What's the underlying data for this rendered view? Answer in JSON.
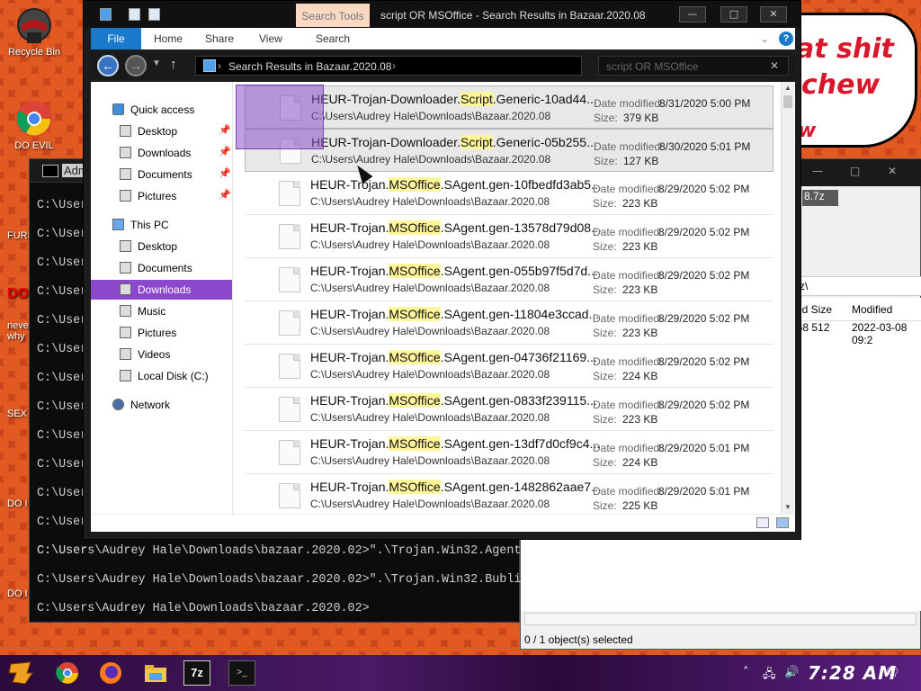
{
  "desktop": {
    "icons": [
      {
        "label": "Recycle Bin"
      },
      {
        "label": "DO EVIL"
      }
    ],
    "side_labels": [
      "FURF",
      "DO",
      "neve why",
      "SEX",
      "DO I",
      "DO I"
    ],
    "comic_lines": [
      "at shit",
      "chew",
      "w"
    ]
  },
  "cmd": {
    "title": "Adm",
    "prompts": [
      "C:\\User",
      "C:\\User",
      "C:\\User",
      "C:\\User",
      "C:\\User",
      "C:\\User",
      "C:\\User",
      "C:\\User",
      "C:\\User",
      "C:\\User",
      "C:\\User",
      "C:\\User",
      "C:\\User"
    ],
    "lines": [
      "C:\\Users\\Audrey Hale\\Downloads\\bazaar.2020.02>\".\\Trojan.Win32.Agent",
      "C:\\Users\\Audrey Hale\\Downloads\\bazaar.2020.02>\".\\Trojan.Win32.Bubli",
      "C:\\Users\\Audrey Hale\\Downloads\\bazaar.2020.02>"
    ]
  },
  "zip": {
    "archive_suffix": "8.7z",
    "path_suffix": "z\\",
    "columns": [
      "ked Size",
      "Modified"
    ],
    "row": {
      "size": "568 512",
      "modified": "2022-03-08 09:2"
    },
    "status": "0 / 1 object(s) selected"
  },
  "explorer": {
    "context_tab": "Search Tools",
    "window_title": "script OR MSOffice - Search Results in Bazaar.2020.08",
    "window_buttons": [
      "—",
      "□",
      "✕"
    ],
    "ribbon_tabs": [
      "File",
      "Home",
      "Share",
      "View",
      "Search"
    ],
    "address": "Search Results in Bazaar.2020.08",
    "address_sep": "›",
    "search_query": "script OR MSOffice",
    "nav_pane": [
      {
        "label": "Quick access",
        "pinned": false,
        "group": true
      },
      {
        "label": "Desktop",
        "pinned": true
      },
      {
        "label": "Downloads",
        "pinned": true
      },
      {
        "label": "Documents",
        "pinned": true
      },
      {
        "label": "Pictures",
        "pinned": true
      },
      {
        "label": "This PC",
        "pinned": false,
        "group": true
      },
      {
        "label": "Desktop",
        "pinned": false
      },
      {
        "label": "Documents",
        "pinned": false
      },
      {
        "label": "Downloads",
        "pinned": false,
        "selected": true
      },
      {
        "label": "Music",
        "pinned": false
      },
      {
        "label": "Pictures",
        "pinned": false
      },
      {
        "label": "Videos",
        "pinned": false
      },
      {
        "label": "Local Disk (C:)",
        "pinned": false
      },
      {
        "label": "Network",
        "pinned": false,
        "group": true
      }
    ],
    "date_label": "Date modified:",
    "size_label": "Size:",
    "results": [
      {
        "pre": "HEUR-Trojan-Downloader.",
        "hl": "Script",
        "post": ".Generic-10ad44...",
        "path": "C:\\Users\\Audrey Hale\\Downloads\\Bazaar.2020.08",
        "date": "8/31/2020 5:00 PM",
        "size": "379 KB"
      },
      {
        "pre": "HEUR-Trojan-Downloader.",
        "hl": "Script",
        "post": ".Generic-05b255...",
        "path": "C:\\Users\\Audrey Hale\\Downloads\\Bazaar.2020.08",
        "date": "8/30/2020 5:01 PM",
        "size": "127 KB"
      },
      {
        "pre": "HEUR-Trojan.",
        "hl": "MSOffice",
        "post": ".SAgent.gen-10fbedfd3ab5...",
        "path": "C:\\Users\\Audrey Hale\\Downloads\\Bazaar.2020.08",
        "date": "8/29/2020 5:02 PM",
        "size": "223 KB"
      },
      {
        "pre": "HEUR-Trojan.",
        "hl": "MSOffice",
        "post": ".SAgent.gen-13578d79d08...",
        "path": "C:\\Users\\Audrey Hale\\Downloads\\Bazaar.2020.08",
        "date": "8/29/2020 5:02 PM",
        "size": "223 KB"
      },
      {
        "pre": "HEUR-Trojan.",
        "hl": "MSOffice",
        "post": ".SAgent.gen-055b97f5d7d...",
        "path": "C:\\Users\\Audrey Hale\\Downloads\\Bazaar.2020.08",
        "date": "8/29/2020 5:02 PM",
        "size": "223 KB"
      },
      {
        "pre": "HEUR-Trojan.",
        "hl": "MSOffice",
        "post": ".SAgent.gen-11804e3ccad...",
        "path": "C:\\Users\\Audrey Hale\\Downloads\\Bazaar.2020.08",
        "date": "8/29/2020 5:02 PM",
        "size": "223 KB"
      },
      {
        "pre": "HEUR-Trojan.",
        "hl": "MSOffice",
        "post": ".SAgent.gen-04736f21169...",
        "path": "C:\\Users\\Audrey Hale\\Downloads\\Bazaar.2020.08",
        "date": "8/29/2020 5:02 PM",
        "size": "224 KB"
      },
      {
        "pre": "HEUR-Trojan.",
        "hl": "MSOffice",
        "post": ".SAgent.gen-0833f239115...",
        "path": "C:\\Users\\Audrey Hale\\Downloads\\Bazaar.2020.08",
        "date": "8/29/2020 5:02 PM",
        "size": "223 KB"
      },
      {
        "pre": "HEUR-Trojan.",
        "hl": "MSOffice",
        "post": ".SAgent.gen-13df7d0cf9c4...",
        "path": "C:\\Users\\Audrey Hale\\Downloads\\Bazaar.2020.08",
        "date": "8/29/2020 5:01 PM",
        "size": "224 KB"
      },
      {
        "pre": "HEUR-Trojan.",
        "hl": "MSOffice",
        "post": ".SAgent.gen-1482862aae7...",
        "path": "C:\\Users\\Audrey Hale\\Downloads\\Bazaar.2020.08",
        "date": "8/29/2020 5:01 PM",
        "size": "225 KB"
      }
    ]
  },
  "taskbar": {
    "apps": [
      "start-icon",
      "chrome-icon",
      "firefox-icon",
      "file-explorer-icon",
      "7zip-icon",
      "cmd-icon"
    ],
    "zip_label": "7z",
    "clock": "7:28 AM"
  },
  "colors": {
    "highlight": "#fff59a",
    "selected_nav": "#8b48cc",
    "accent": "#1979ca"
  }
}
